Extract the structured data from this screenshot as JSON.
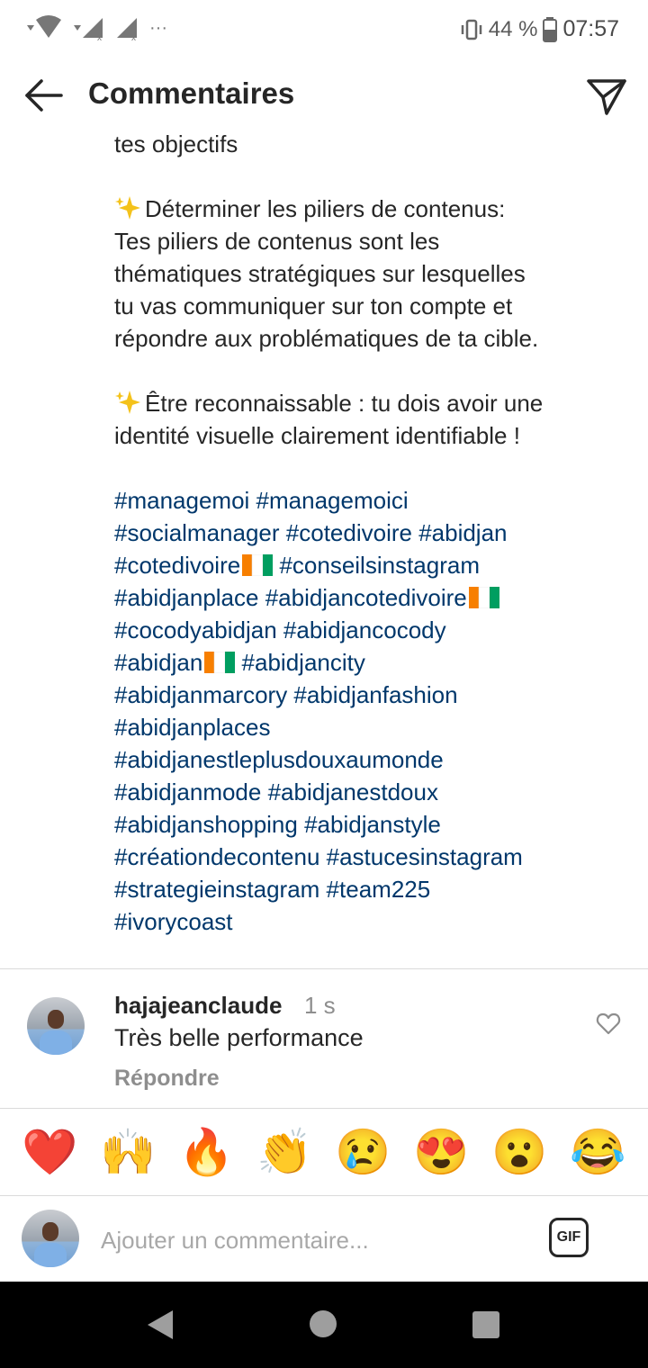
{
  "status_bar": {
    "battery": "44 %",
    "time": "07:57",
    "more": "···"
  },
  "header": {
    "title": "Commentaires",
    "back_icon": "arrow-left-icon",
    "send_icon": "paper-plane-icon"
  },
  "caption": {
    "lines_top": [
      "tes objectifs"
    ],
    "paragraph2": [
      "Déterminer les piliers de contenus:",
      "Tes piliers de contenus sont les",
      "thématiques stratégiques sur lesquelles",
      "tu vas communiquer sur ton compte et",
      "répondre aux problématiques de ta cible."
    ],
    "paragraph3": [
      "Être reconnaissable : tu dois avoir une",
      "identité visuelle clairement identifiable !"
    ],
    "hashtags": [
      "#managemoi #managemoici",
      "#socialmanager #cotedivoire #abidjan",
      "#cotedivoire",
      "#conseilsinstagram",
      "#abidjanplace #abidjancotedivoire",
      "#cocodyabidjan #abidjancocody",
      "#abidjan",
      "#abidjancity",
      "#abidjanmarcory #abidjanfashion",
      "#abidjanplaces",
      "#abidjanestleplusdouxaumonde",
      "#abidjanmode #abidjanestdoux",
      "#abidjanshopping #abidjanstyle",
      "#créationdecontenu #astucesinstagram",
      "#strategieinstagram #team225",
      "#ivorycoast"
    ]
  },
  "comment": {
    "username": "hajajeanclaude",
    "time": "1 s",
    "text": "Très belle performance",
    "reply": "Répondre"
  },
  "emoji_bar": [
    "❤️",
    "🙌",
    "🔥",
    "👏",
    "😢",
    "😍",
    "😮",
    "😂"
  ],
  "input": {
    "placeholder": "Ajouter un commentaire...",
    "gif_label": "GIF"
  }
}
